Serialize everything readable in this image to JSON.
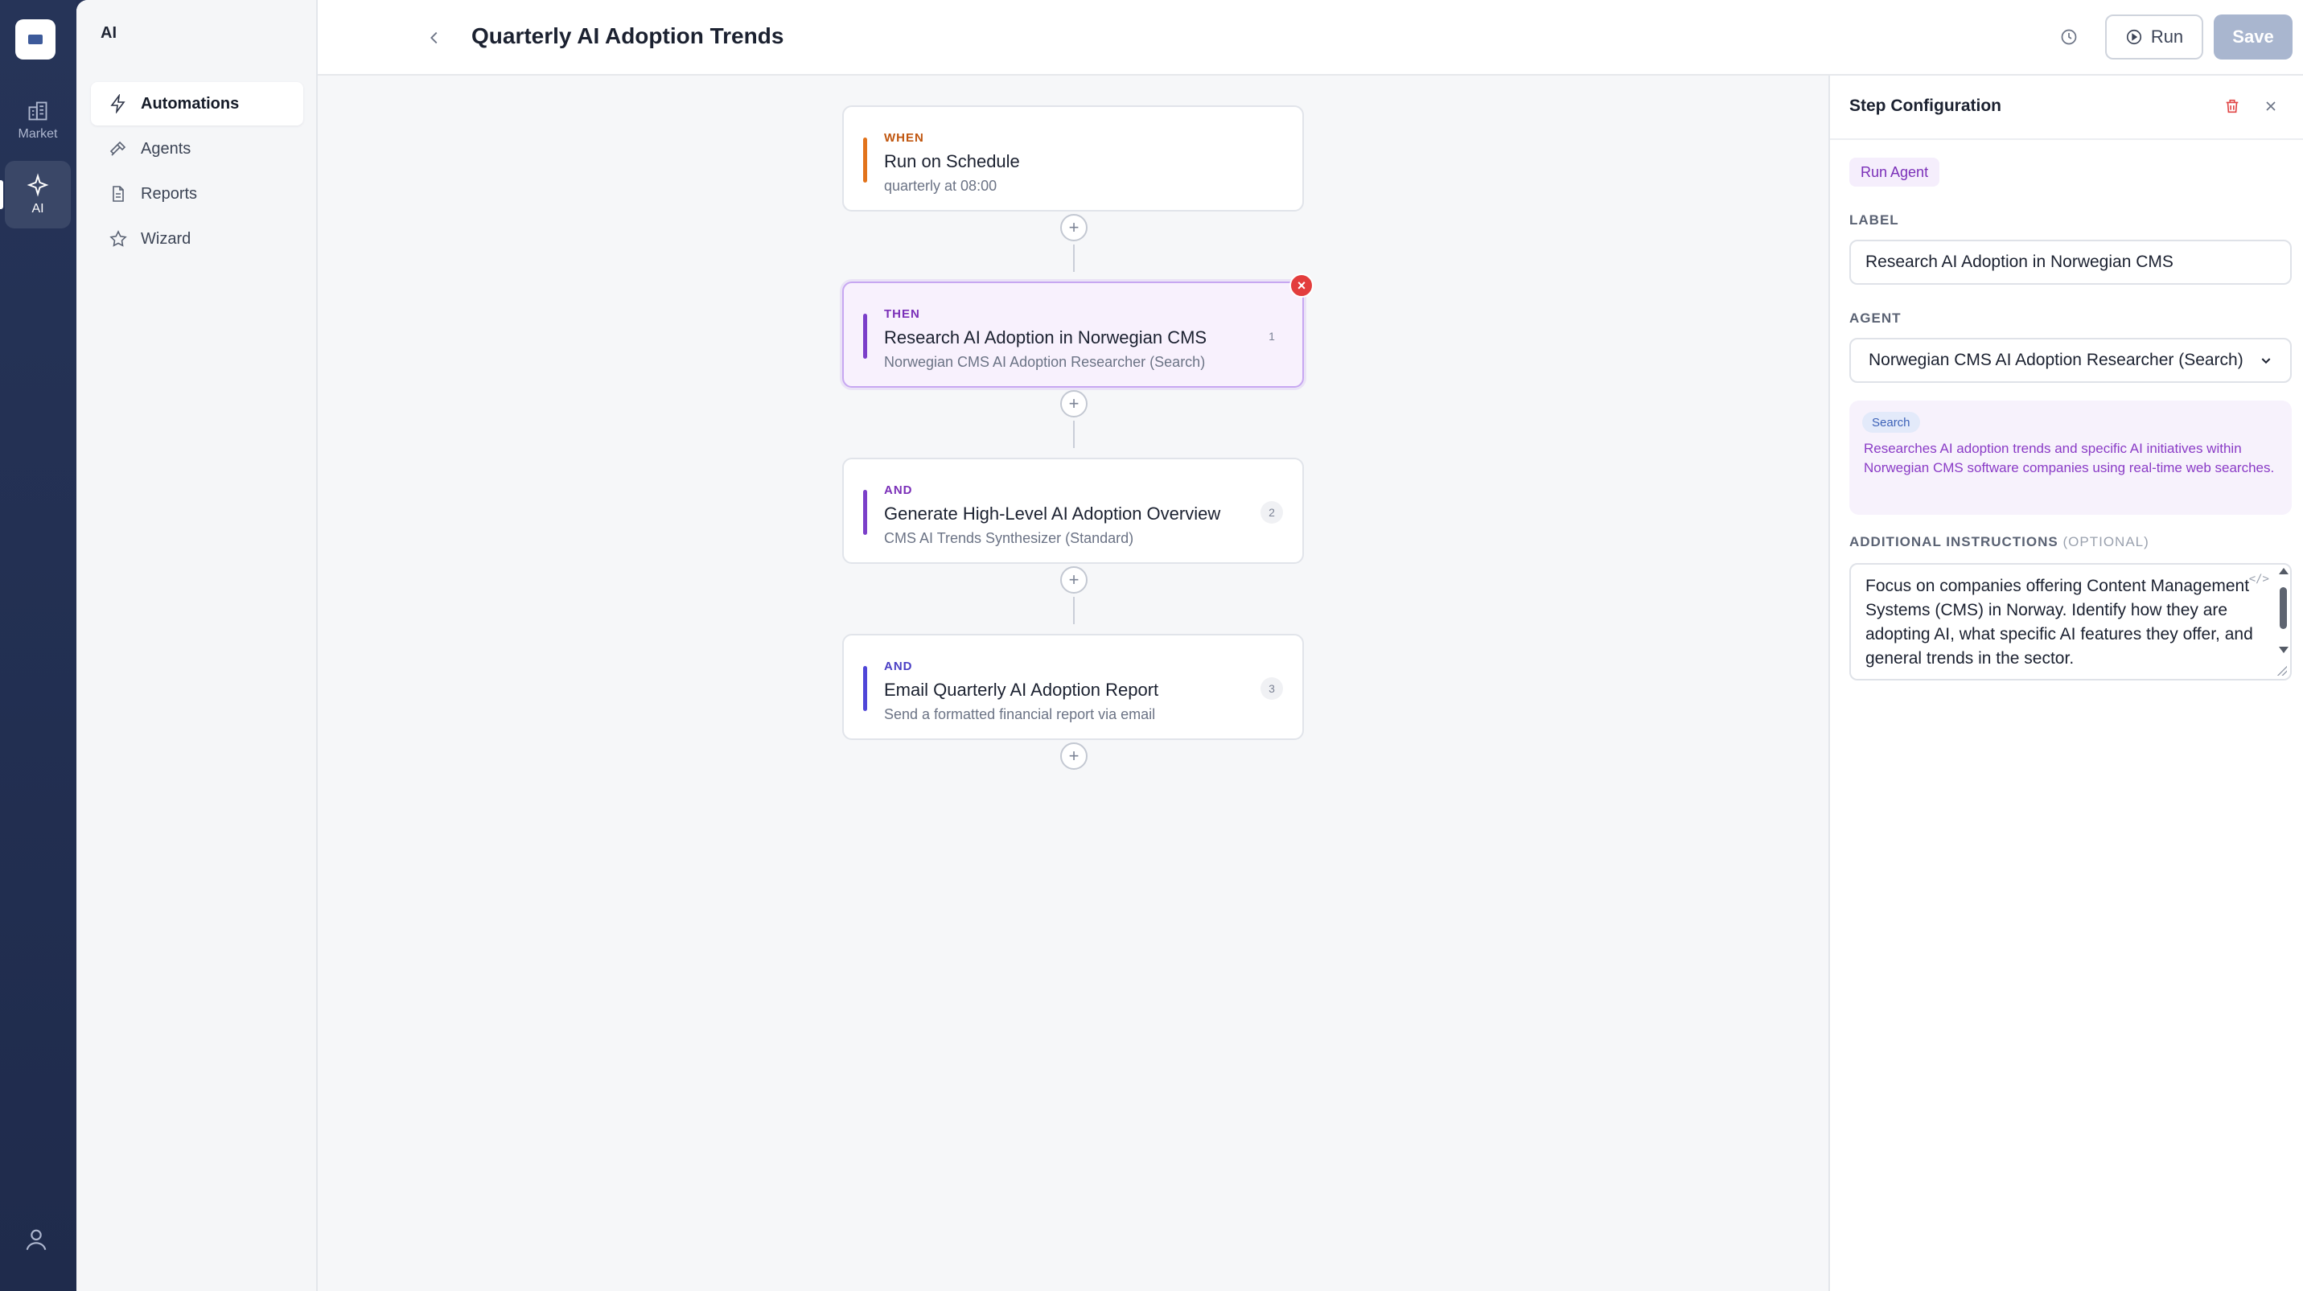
{
  "rail": {
    "items": [
      {
        "label": "Market",
        "icon": "building-icon"
      },
      {
        "label": "AI",
        "icon": "sparkle-icon"
      }
    ]
  },
  "sidebar": {
    "title": "AI",
    "items": [
      {
        "label": "Automations",
        "icon": "bolt-icon",
        "active": true
      },
      {
        "label": "Agents",
        "icon": "hammer-icon"
      },
      {
        "label": "Reports",
        "icon": "document-icon"
      },
      {
        "label": "Wizard",
        "icon": "star-icon"
      }
    ]
  },
  "header": {
    "title": "Quarterly AI Adoption Trends",
    "run_label": "Run",
    "save_label": "Save"
  },
  "workflow": {
    "steps": [
      {
        "kind": "WHEN",
        "title": "Run on Schedule",
        "subtitle": "quarterly at 08:00",
        "number": "",
        "accent": "#e2731b",
        "kind_color": "#c0560f"
      },
      {
        "kind": "THEN",
        "title": "Research AI Adoption in Norwegian CMS",
        "subtitle": "Norwegian CMS AI Adoption Researcher (Search)",
        "number": "1",
        "accent": "#7b3fc9",
        "kind_color": "#7a2fb8",
        "selected": true
      },
      {
        "kind": "AND",
        "title": "Generate High-Level AI Adoption Overview",
        "subtitle": "CMS AI Trends Synthesizer (Standard)",
        "number": "2",
        "accent": "#7b3fc9",
        "kind_color": "#7a2fb8"
      },
      {
        "kind": "AND",
        "title": "Email Quarterly AI Adoption Report",
        "subtitle": "Send a formatted financial report via email",
        "number": "3",
        "accent": "#4f46d8",
        "kind_color": "#4a3fc4"
      }
    ]
  },
  "panel": {
    "title": "Step Configuration",
    "type_pill": "Run Agent",
    "label_heading": "LABEL",
    "label_value": "Research AI Adoption in Norwegian CMS",
    "agent_heading": "AGENT",
    "agent_value": "Norwegian CMS AI Adoption Researcher (Search)",
    "info_tag": "Search",
    "info_text": "Researches AI adoption trends and specific AI initiatives within Norwegian CMS software companies using real-time web searches.",
    "instructions_heading": "ADDITIONAL INSTRUCTIONS",
    "instructions_optional": "(OPTIONAL)",
    "instructions_value": "Focus on companies offering Content Management Systems (CMS) in Norway. Identify how they are adopting AI, what specific AI features they offer, and general trends in the sector."
  },
  "colors": {
    "rail_bg": "#243155",
    "accent_purple": "#7b3fc9",
    "danger": "#e33d3d",
    "save_disabled": "#a9b6cf"
  }
}
